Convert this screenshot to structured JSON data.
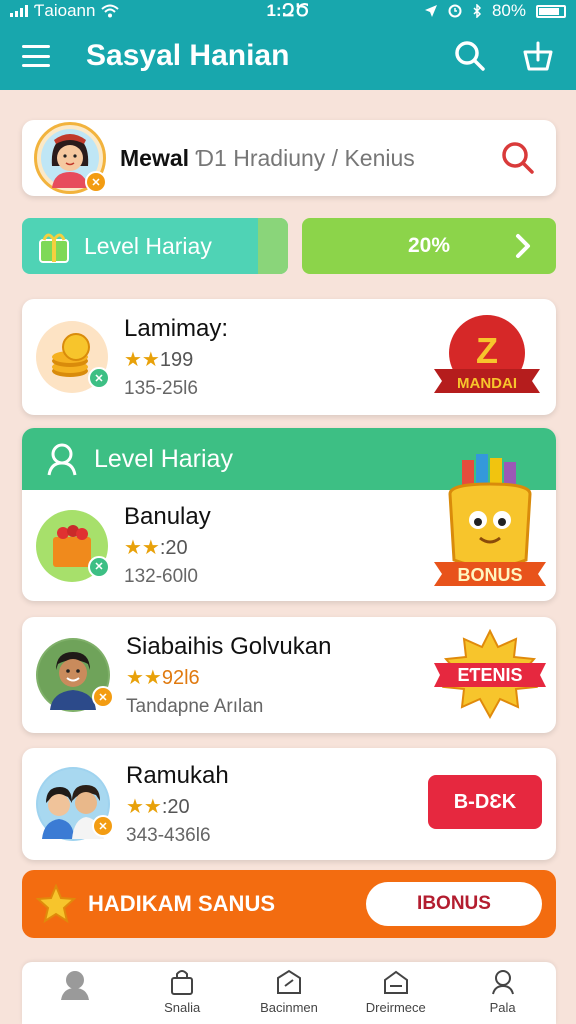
{
  "status_bar": {
    "carrier": "Ƭaioann",
    "time": "1:ԶԾ",
    "battery": "80%"
  },
  "app_bar": {
    "title": "Sasyal Hanian"
  },
  "search_card": {
    "name": "Mewal",
    "prefix": "Ɗ1",
    "subtitle": "Hradiuny",
    "separator": "/",
    "location": "Kenius"
  },
  "level_row": {
    "level_label": "Level Hariay",
    "progress_text": "20%",
    "progress_value": 0.2
  },
  "items": [
    {
      "name": "Lamimay:",
      "stars": "★★",
      "rating": "199",
      "meta": "135-25Ɩ6",
      "ribbon": "MANDAI"
    },
    {
      "header": "Level Hariay",
      "name": "Banulay",
      "stars": "★★",
      "rating": ":20",
      "meta": "132-60Ɩ0",
      "ribbon": "BONUS"
    },
    {
      "name": "Siabaihis Golvukan",
      "stars": "★★",
      "rating": "92Ɩ6",
      "meta": "Tandapne Arılan",
      "ribbon": "EƬENIS"
    },
    {
      "name": "Ramukah",
      "stars": "★★",
      "rating": ":20",
      "meta": "343-436Ɩ6",
      "button": "B-DƐK"
    }
  ],
  "promo": {
    "label": "HADIKAM SANUS",
    "button": "ƖBONUS"
  },
  "bottom_nav": [
    {
      "label": ""
    },
    {
      "label": "Snalia"
    },
    {
      "label": "Bacinmen"
    },
    {
      "label": "Dreirmece"
    },
    {
      "label": "Pala"
    }
  ],
  "colors": {
    "primary": "#18a7ad",
    "background": "#f7e3da",
    "accent_green": "#3dbf84",
    "accent_orange": "#f36c10",
    "accent_red": "#e6283f"
  }
}
